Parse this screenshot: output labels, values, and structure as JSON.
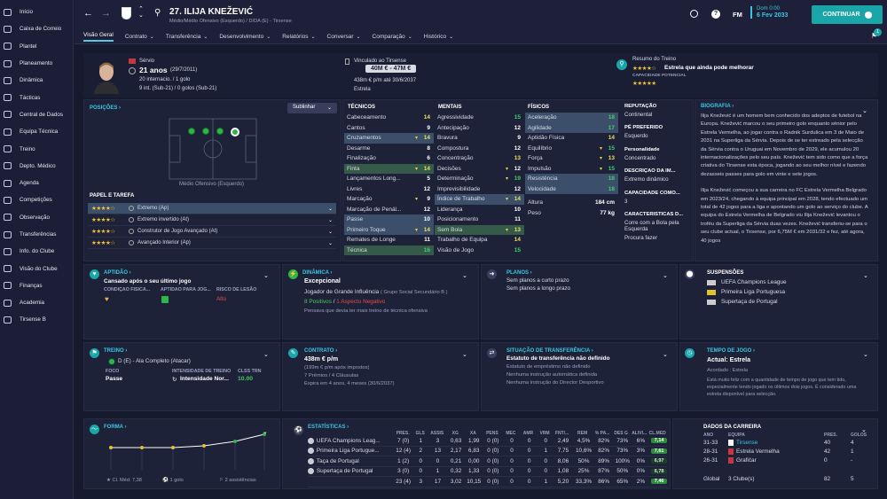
{
  "sidebar": {
    "items": [
      {
        "label": "Início",
        "icon": "home-icon"
      },
      {
        "label": "Caixa de Correio",
        "icon": "mail-icon"
      },
      {
        "label": "Plantel",
        "icon": "squad-icon"
      },
      {
        "label": "Planeamento",
        "icon": "calendar-icon"
      },
      {
        "label": "Dinâmica",
        "icon": "dynamics-icon"
      },
      {
        "label": "Tácticas",
        "icon": "tactics-icon"
      },
      {
        "label": "Central de Dados",
        "icon": "data-icon"
      },
      {
        "label": "Equipa Técnica",
        "icon": "staff-icon"
      },
      {
        "label": "Treino",
        "icon": "training-icon"
      },
      {
        "label": "Depto. Médico",
        "icon": "medical-icon"
      },
      {
        "label": "Agenda",
        "icon": "agenda-icon"
      },
      {
        "label": "Competições",
        "icon": "trophy-icon"
      },
      {
        "label": "Observação",
        "icon": "scouting-icon"
      },
      {
        "label": "Transferências",
        "icon": "transfer-icon"
      },
      {
        "label": "Info. do Clube",
        "icon": "club-info-icon"
      },
      {
        "label": "Visão do Clube",
        "icon": "club-vision-icon"
      },
      {
        "label": "Finanças",
        "icon": "finance-icon"
      },
      {
        "label": "Academia",
        "icon": "academy-icon"
      },
      {
        "label": "Tirsense B",
        "icon": "team-b-icon"
      }
    ]
  },
  "header": {
    "player_title": "27. ILIJA KNEŽEVIĆ",
    "subtitle": "Médio/Médio Ofensivo (Esquerdo) / D/DA (E) - Tirsense",
    "date_day": "Dom 0:00",
    "date": "6 Fev 2033",
    "continue_label": "CONTINUAR",
    "fm_label": "FM",
    "notif_count": "1"
  },
  "tabs": [
    {
      "label": "Visão Geral"
    },
    {
      "label": "Contrato"
    },
    {
      "label": "Transferência"
    },
    {
      "label": "Desenvolvimento"
    },
    {
      "label": "Relatórios"
    },
    {
      "label": "Conversar"
    },
    {
      "label": "Comparação"
    },
    {
      "label": "Histórico"
    }
  ],
  "profile": {
    "nationality": "Sérvio",
    "age": "21 anos",
    "dob": "(29/7/2011)",
    "intl": "20 internacio. / 1 golo",
    "u21": "9 int. (Sub-21) / 0 golos (Sub-21)",
    "club_label": "Vinculado ao Tirsense",
    "value": "40M € - 47M €",
    "wage": "438m € p/m até 30/6/2037",
    "club": "Estrela",
    "report_label": "Resumo do Treino",
    "report_text": "Estrela que ainda pode melhorar",
    "potential_label": "CAPACIDADE POTENCIAL"
  },
  "positions": {
    "title": "POSIÇÕES",
    "highlight_label": "Sublinhar",
    "position_caption": "Médio Ofensivo (Esquerdo)",
    "roles_title": "PAPEL E TAREFA",
    "roles": [
      {
        "name": "Extremo (Ap)"
      },
      {
        "name": "Extremo invertido (At)"
      },
      {
        "name": "Construtor de Jogo Avançado (At)"
      },
      {
        "name": "Avançado Interior (Ap)"
      }
    ]
  },
  "technical": {
    "title": "TÉCNICOS",
    "items": [
      {
        "name": "Cabeceamento",
        "value": "14"
      },
      {
        "name": "Cantos",
        "value": "9"
      },
      {
        "name": "Cruzamentos",
        "value": "14"
      },
      {
        "name": "Desarme",
        "value": "8"
      },
      {
        "name": "Finalização",
        "value": "6"
      },
      {
        "name": "Finta",
        "value": "14"
      },
      {
        "name": "Lançamentos Long...",
        "value": "5"
      },
      {
        "name": "Livres",
        "value": "12"
      },
      {
        "name": "Marcação",
        "value": "9"
      },
      {
        "name": "Marcação de Penál...",
        "value": "12"
      },
      {
        "name": "Passe",
        "value": "10"
      },
      {
        "name": "Primeiro Toque",
        "value": "14"
      },
      {
        "name": "Remates de Longe",
        "value": "11"
      },
      {
        "name": "Técnica",
        "value": "16"
      }
    ]
  },
  "mental": {
    "title": "MENTAIS",
    "items": [
      {
        "name": "Agressividade",
        "value": "15"
      },
      {
        "name": "Antecipação",
        "value": "12"
      },
      {
        "name": "Bravura",
        "value": "9"
      },
      {
        "name": "Compostura",
        "value": "12"
      },
      {
        "name": "Concentração",
        "value": "13"
      },
      {
        "name": "Decisões",
        "value": "12"
      },
      {
        "name": "Determinação",
        "value": "19"
      },
      {
        "name": "Imprevisibilidade",
        "value": "12"
      },
      {
        "name": "Índice de Trabalho",
        "value": "14"
      },
      {
        "name": "Liderança",
        "value": "10"
      },
      {
        "name": "Posicionamento",
        "value": "11"
      },
      {
        "name": "Sem Bola",
        "value": "13"
      },
      {
        "name": "Trabalho de Equipa",
        "value": "14"
      },
      {
        "name": "Visão de Jogo",
        "value": "15"
      }
    ]
  },
  "physical": {
    "title": "FÍSICOS",
    "items": [
      {
        "name": "Aceleração",
        "value": "18"
      },
      {
        "name": "Agilidade",
        "value": "17"
      },
      {
        "name": "Aptidão Física",
        "value": "14"
      },
      {
        "name": "Equilíbrio",
        "value": "15"
      },
      {
        "name": "Força",
        "value": "13"
      },
      {
        "name": "Impulsão",
        "value": "15"
      },
      {
        "name": "Resistência",
        "value": "18"
      },
      {
        "name": "Velocidade",
        "value": "18"
      }
    ],
    "height_label": "Altura",
    "height": "184 cm",
    "weight_label": "Peso",
    "weight": "77 kg"
  },
  "personal": {
    "reputation_label": "REPUTAÇÃO",
    "reputation": "Continental",
    "foot_label": "PÉ PREFERIDO",
    "foot": "Esquerdo",
    "personality_label": "Personalidade",
    "personality": "Concentrado",
    "media_label": "DESCRIÇÃO DA IM...",
    "media": "Extremo dinâmico",
    "ability_label": "CAPACIDADE COMO...",
    "ability": "3",
    "traits_label": "CARACTERÍSTICAS D...",
    "trait1": "Corre com a Bola pela Esquerda",
    "trait2": "Procura fazer"
  },
  "biography": {
    "title": "BIOGRAFIA",
    "p1": "Ilija Knežević é um homem bem conhecido dos adeptos de futebol na Europa. Knežević marcou o seu primeiro golo enquanto sénior pelo Estrela Vermelha, ao jogar contra o Radnik Surdulica em 3 de Maio de 2031 na Superliga da Sérvia. Depois de se ter estreado pela selecção da Sérvia contra o Uruguai em Novembro de 2029, ele acumulou 20 internacionalizações pelo seu país. Knežević tem sido como que a força criativa do Tirsense esta época, jogando ao seu melhor nível e fazendo dezasseis passes para golo em vinte e sete jogos.",
    "p2": "Ilija Knežević começou a sua carreira no FC Estrela Vermelha Belgrado em 2023/24, chegando à equipa principal em 2028, tendo efectuado um total de 42 jogos para a liga e apontando um golo ao serviço do clube. A equipa do Estrela Vermelha de Belgrado viu Ilija Knežević levantou o troféu da Superliga da Sérvia duas vezes. Knežević transferiu-se para o seu clube actual, o Tirsense, por 6,75M € em 2031/32 e fez, até agora, 40 jogos"
  },
  "fitness": {
    "title": "APTIDÃO",
    "text": "Cansado após o seu último jogo",
    "col1": "CONDIÇÃO FÍSICA...",
    "col2": "APTIDÃO PARA JOG...",
    "col3": "RISCO DE LESÃO",
    "risk": "Alto"
  },
  "dynamics": {
    "title": "DINÂMICA",
    "status": "Excepcional",
    "role": "Jogador de Grande Influência",
    "group": "( Grupo Social Secundário B )",
    "positives": "8 Positivos",
    "separator": "/",
    "negatives": "1 Aspecto Negativo",
    "note": "Pensava que devia ter mais treino de técnica ofensiva"
  },
  "plans": {
    "title": "PLANOS",
    "short": "Sem planos a curto prazo",
    "long": "Sem planos a longo prazo"
  },
  "suspensions": {
    "title": "SUSPENSÕES",
    "items": [
      "UEFA Champions League",
      "Primeira Liga Portuguesa",
      "Supertaça de Portugal"
    ]
  },
  "training": {
    "title": "TREINO",
    "role": "D (E) - Ala Completo (Atacar)",
    "focus_label": "FOCO",
    "focus": "Passe",
    "intensity_label": "INTENSIDADE DE TREINO",
    "intensity": "Intensidade Nor...",
    "rating_label": "CLSS TRN",
    "rating": "10.00"
  },
  "contract": {
    "title": "CONTRATO",
    "wage": "438m € p/m",
    "wage_note": "(199m € p/m após impostos)",
    "bonuses": "7 Prémios / 4 Cláusulas",
    "expiry": "Expira em 4 anos, 4 meses (30/6/2037)"
  },
  "transfer": {
    "title": "SITUAÇÃO DE TRANSFERÊNCIA",
    "status": "Estatuto de transferência não definido",
    "l1": "Estatuto de empréstimo não definido",
    "l2": "Nenhuma instrução automática definida",
    "l3": "Nenhuma instrução do Director Desportivo"
  },
  "playing_time": {
    "title": "TEMPO DE JOGO",
    "status": "Actual: Estrela",
    "agreed": "Acordado : Estrela",
    "note": "Está muito feliz com a quantidade de tempo de jogo que tem tido, especialmente tendo jogado os últimos dois jogos. É considerado uma estrela disponível para selecção."
  },
  "form": {
    "title": "FORMA",
    "avg": "Cl. Méd: 7,38",
    "goals": "1 golo",
    "assists": "2 assistências"
  },
  "stats": {
    "title": "ESTATÍSTICAS",
    "headers": [
      "PRES.",
      "GLS",
      "ASSIS",
      "XG",
      "XA",
      "PENS",
      "MEC",
      "AMR",
      "VRM",
      "FNT/...",
      "REM",
      "% PA...",
      "DES G",
      "ALIVI...",
      "CL.MED"
    ],
    "rows": [
      {
        "comp": "UEFA Champions Leag...",
        "c": [
          "7 (0)",
          "1",
          "3",
          "0,63",
          "1,99",
          "0 (0)",
          "0",
          "0",
          "0",
          "2,49",
          "4,5%",
          "82%",
          "73%",
          "6%",
          "7,14"
        ]
      },
      {
        "comp": "Primeira Liga Portugue...",
        "c": [
          "12 (4)",
          "2",
          "13",
          "2,17",
          "6,83",
          "0 (0)",
          "0",
          "0",
          "1",
          "7,75",
          "10,6%",
          "82%",
          "73%",
          "3%",
          "7,61"
        ]
      },
      {
        "comp": "Taça de Portugal",
        "c": [
          "1 (2)",
          "0",
          "0",
          "0,21",
          "0,00",
          "0 (0)",
          "0",
          "0",
          "0",
          "8,06",
          "50%",
          "89%",
          "100%",
          "0%",
          "6,97"
        ]
      },
      {
        "comp": "Supertaça de Portugal",
        "c": [
          "3 (0)",
          "0",
          "1",
          "0,32",
          "1,33",
          "0 (0)",
          "0",
          "0",
          "0",
          "1,08",
          "25%",
          "87%",
          "50%",
          "0%",
          "6,78"
        ]
      },
      {
        "comp": "",
        "c": [
          "23 (4)",
          "3",
          "17",
          "3,02",
          "10,15",
          "0 (0)",
          "0",
          "0",
          "1",
          "5,20",
          "33,3%",
          "86%",
          "65%",
          "2%",
          "7,46"
        ]
      }
    ]
  },
  "career": {
    "title": "DADOS DA CARREIRA",
    "headers": [
      "ANO",
      "EQUIPA",
      "PRES.",
      "GOLOS"
    ],
    "rows": [
      {
        "year": "31-33",
        "team": "Tirsense",
        "apps": "40",
        "goals": "4"
      },
      {
        "year": "28-31",
        "team": "Estrela Vermelha",
        "apps": "42",
        "goals": "1"
      },
      {
        "year": "26-31",
        "team": "Grafičar",
        "apps": "0",
        "goals": "-"
      }
    ],
    "total_label": "Global",
    "total_clubs": "3 Clube(s)",
    "total_apps": "82",
    "total_goals": "5"
  },
  "colors": {
    "accent": "#39c6e2",
    "bg": "#161a2f",
    "panel": "#1e2239",
    "green": "#47c75a"
  }
}
